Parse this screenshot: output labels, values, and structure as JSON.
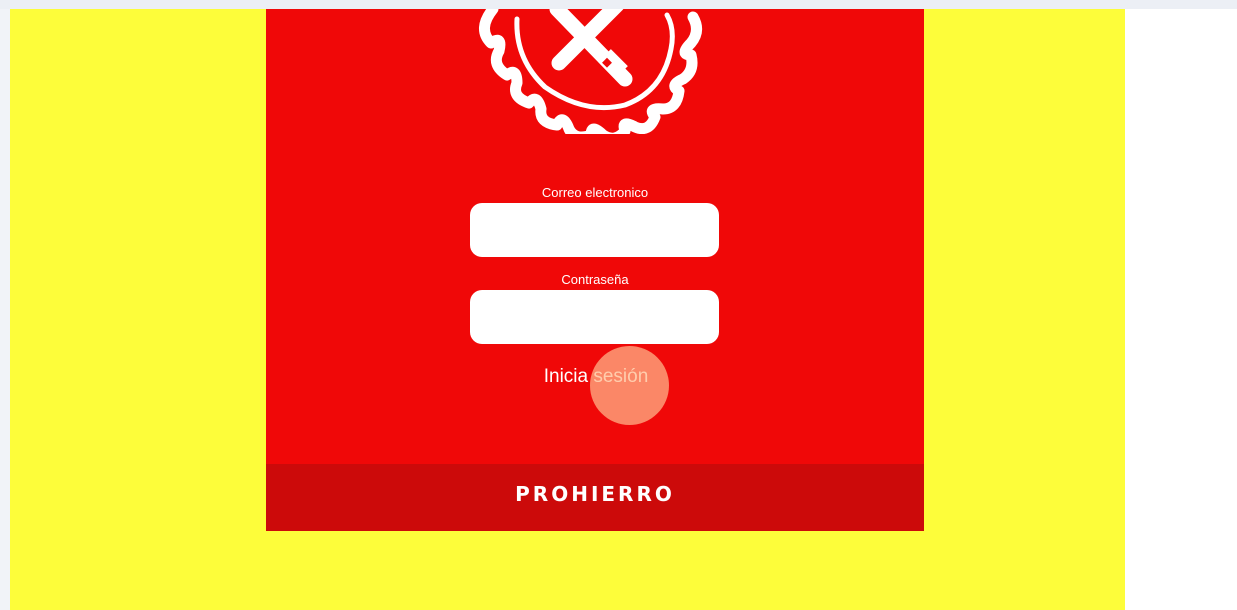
{
  "form": {
    "email_label": "Correo electronico",
    "email_value": "",
    "password_label": "Contraseña",
    "password_value": "",
    "login_label": "Inicia sesión"
  },
  "footer": {
    "brand": "PROHIERRO"
  },
  "icons": {
    "logo": "saw-blade-hammer-logo-icon"
  },
  "colors": {
    "page_background": "#fdfd3a",
    "card_red": "#f00808",
    "footer_red": "#cc0a0a",
    "text_white": "#ffffff"
  }
}
